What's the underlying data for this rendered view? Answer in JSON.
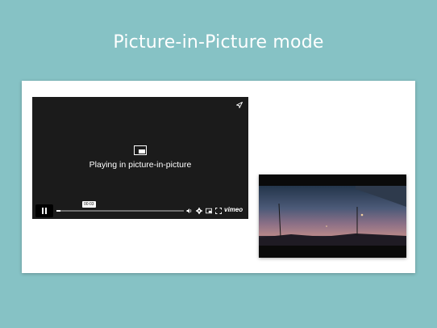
{
  "slide": {
    "title": "Picture-in-Picture mode"
  },
  "player": {
    "message": "Playing in picture-in-picture",
    "message_icon": "pip-icon",
    "share_icon": "share-icon",
    "controls": {
      "play_pause_icon": "pause-icon",
      "current_time": "00:03",
      "progress": 0.03,
      "volume_icon": "volume-icon",
      "settings_icon": "gear-icon",
      "pip_icon": "pip-toggle-icon",
      "fullscreen_icon": "fullscreen-icon",
      "logo": "vimeo"
    }
  },
  "pip_window": {
    "content": "dusk highway scene"
  },
  "colors": {
    "background": "#86c2c5",
    "card": "#ffffff",
    "player": "#1b1b1b"
  }
}
